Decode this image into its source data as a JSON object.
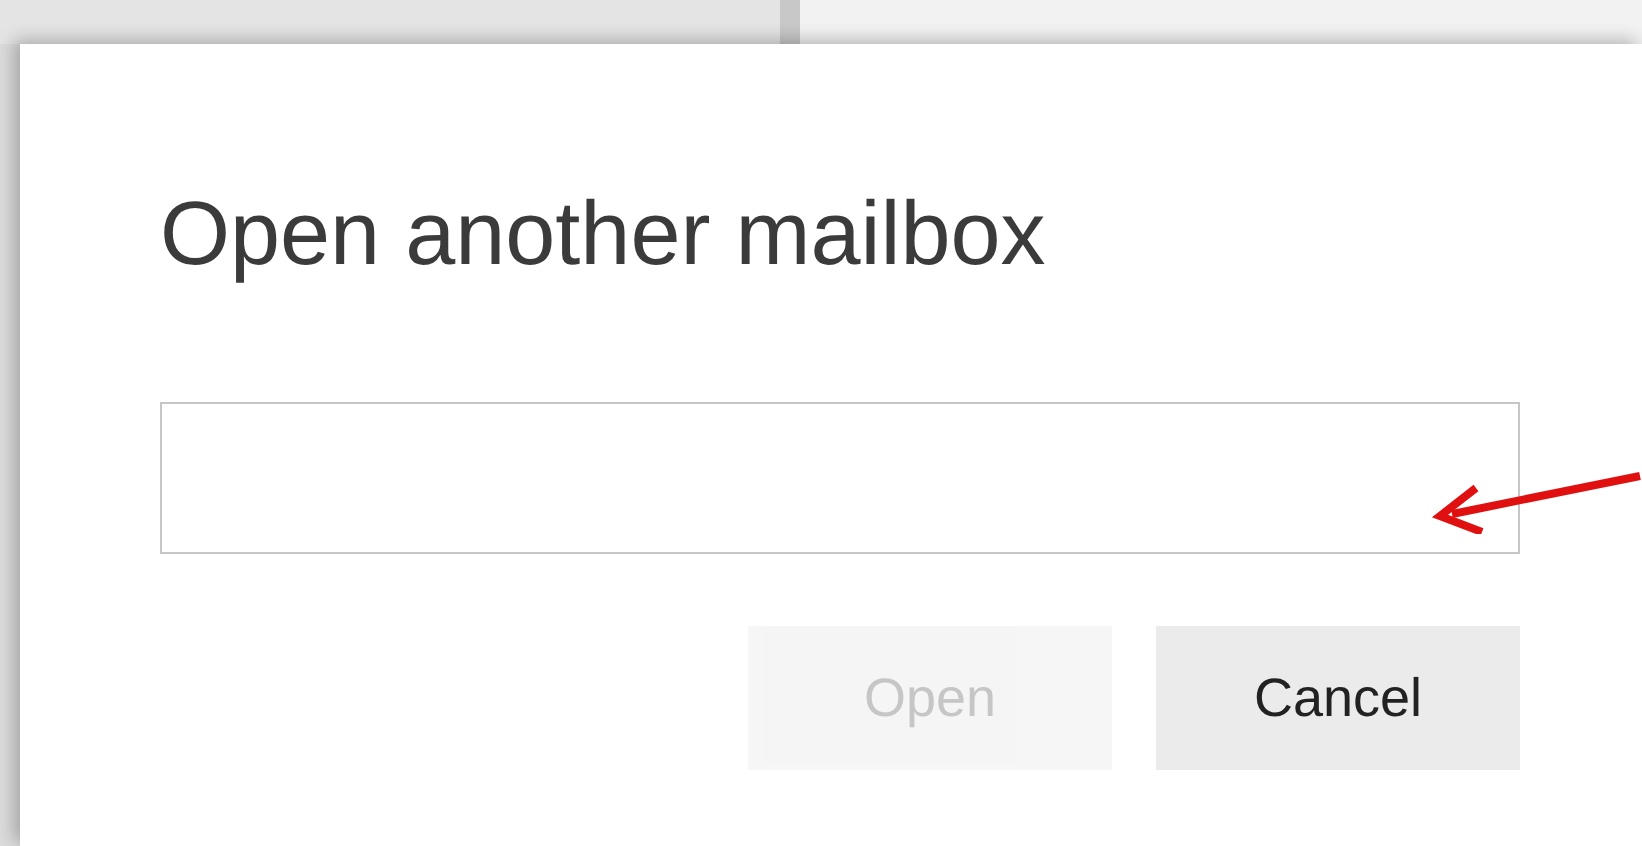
{
  "dialog": {
    "title": "Open another mailbox"
  },
  "buttons": [
    {
      "label": "Open",
      "disabled": true
    },
    {
      "label": "Cancel",
      "disabled": false
    }
  ]
}
